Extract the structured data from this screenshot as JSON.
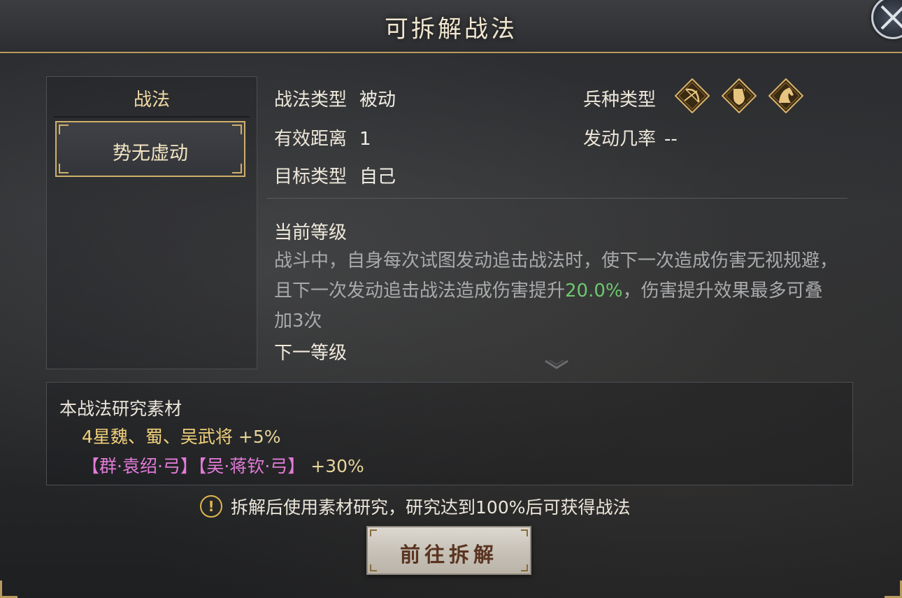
{
  "window": {
    "title": "可拆解战法"
  },
  "skill_list": {
    "header": "战法",
    "items": [
      {
        "label": "势无虚动",
        "selected": true
      }
    ]
  },
  "attributes": {
    "skill_type": {
      "label": "战法类型",
      "value": "被动"
    },
    "range": {
      "label": "有效距离",
      "value": "1"
    },
    "target_type": {
      "label": "目标类型",
      "value": "自己"
    },
    "troop_type": {
      "label": "兵种类型",
      "icons": [
        "bow-icon",
        "shield-icon",
        "horse-icon"
      ]
    },
    "trigger_rate": {
      "label": "发动几率",
      "value": "--"
    }
  },
  "levels": {
    "current_label": "当前等级",
    "description_pre": "战斗中，自身每次试图发动追击战法时，使下一次造成伤害无视规避，且下一次发动追击战法造成伤害提升",
    "description_highlight": "20.0%",
    "description_post": "，伤害提升效果最多可叠加3次",
    "next_label": "下一等级"
  },
  "materials": {
    "title": "本战法研究素材",
    "line1_text": "4星魏、蜀、吴武将",
    "line1_pct": "+5%",
    "line2_text": "【群·袁绍·弓】【吴·蒋钦·弓】",
    "line2_pct": "+30%"
  },
  "notice": {
    "icon": "!",
    "text": "拆解后使用素材研究，研究达到100%后可获得战法"
  },
  "action_button": {
    "label": "前往拆解"
  },
  "colors": {
    "gold": "#cfb069",
    "highlight_green": "#6cc86c",
    "pink": "#e27bd8"
  }
}
